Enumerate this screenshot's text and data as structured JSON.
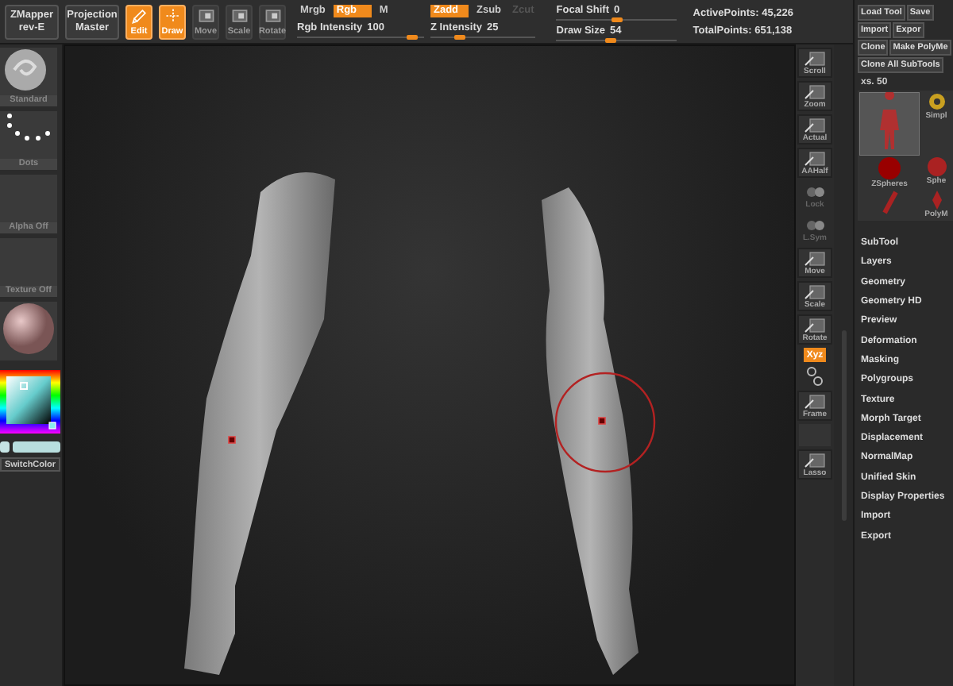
{
  "top_bar": {
    "menus": [
      {
        "label": "ZMapper",
        "sub": "rev-E"
      },
      {
        "label": "Projection",
        "sub": "Master"
      }
    ],
    "tools": [
      {
        "label": "Edit",
        "selected": true
      },
      {
        "label": "Draw",
        "selected": true
      },
      {
        "label": "Move",
        "selected": false
      },
      {
        "label": "Scale",
        "selected": false
      },
      {
        "label": "Rotate",
        "selected": false
      }
    ],
    "color_modes": [
      {
        "label": "Mrgb",
        "on": false
      },
      {
        "label": "Rgb",
        "on": true
      },
      {
        "label": "M",
        "on": false
      }
    ],
    "rgb_intensity": {
      "label": "Rgb Intensity",
      "value": "100",
      "level": 0.9
    },
    "z_modes": [
      {
        "label": "Zadd",
        "on": true,
        "disabled": false
      },
      {
        "label": "Zsub",
        "on": false,
        "disabled": false
      },
      {
        "label": "Zcut",
        "on": false,
        "disabled": true
      }
    ],
    "z_intensity": {
      "label": "Z Intensity",
      "value": "25",
      "level": 0.28
    },
    "focal_shift": {
      "label": "Focal Shift",
      "value": "0",
      "level": 0.5
    },
    "draw_size": {
      "label": "Draw Size",
      "value": "54",
      "level": 0.45
    },
    "stats": [
      {
        "label": "ActivePoints:",
        "value": "45,226"
      },
      {
        "label": "TotalPoints:",
        "value": "651,138"
      }
    ]
  },
  "left_panel": {
    "slots": [
      {
        "kind": "brush",
        "label": "Standard"
      },
      {
        "kind": "stroke",
        "label": "Dots"
      },
      {
        "kind": "alpha",
        "label": "Alpha Off"
      },
      {
        "kind": "texture",
        "label": "Texture Off"
      },
      {
        "kind": "material"
      }
    ],
    "switch_color": "SwitchColor"
  },
  "shelf": [
    {
      "kind": "icon",
      "label": "Scroll",
      "disabled": false
    },
    {
      "kind": "icon",
      "label": "Zoom",
      "disabled": false
    },
    {
      "kind": "icon",
      "label": "Actual",
      "disabled": false
    },
    {
      "kind": "icon",
      "label": "AAHalf",
      "disabled": false
    },
    {
      "kind": "icon",
      "label": "Lock",
      "disabled": true
    },
    {
      "kind": "icon",
      "label": "L.Sym",
      "disabled": true
    },
    {
      "kind": "icon",
      "label": "Move",
      "disabled": false
    },
    {
      "kind": "icon",
      "label": "Scale",
      "disabled": false
    },
    {
      "kind": "icon",
      "label": "Rotate",
      "disabled": false
    },
    {
      "kind": "badge",
      "label": "Xyz",
      "on": true
    },
    {
      "kind": "axes"
    },
    {
      "kind": "icon",
      "label": "Frame",
      "disabled": false
    },
    {
      "kind": "blank"
    },
    {
      "kind": "icon",
      "label": "Lasso",
      "disabled": false
    }
  ],
  "tool_panel": {
    "rows": [
      {
        "buttons": [
          "Load Tool",
          "Save"
        ]
      },
      {
        "buttons": [
          "Import",
          "Expor"
        ]
      },
      {
        "buttons": [
          "Clone",
          "Make PolyMe"
        ]
      },
      {
        "buttons": [
          "Clone All SubTools"
        ]
      }
    ],
    "size_label": "xs. 50",
    "thumbnails": [
      {
        "kind": "figure"
      },
      {
        "kind": "simple",
        "label": "Simpl"
      },
      {
        "kind": "zsphere",
        "label": "ZSpheres"
      },
      {
        "kind": "sphere",
        "label": "Sphe"
      },
      {
        "kind": "stick"
      },
      {
        "kind": "polymesh",
        "label": "PolyM"
      }
    ],
    "menu": [
      "SubTool",
      "Layers",
      "Geometry",
      "Geometry HD",
      "Preview",
      "Deformation",
      "Masking",
      "Polygroups",
      "Texture",
      "Morph Target",
      "Displacement",
      "NormalMap",
      "Unified Skin",
      "Display Properties",
      "Import",
      "Export"
    ]
  }
}
